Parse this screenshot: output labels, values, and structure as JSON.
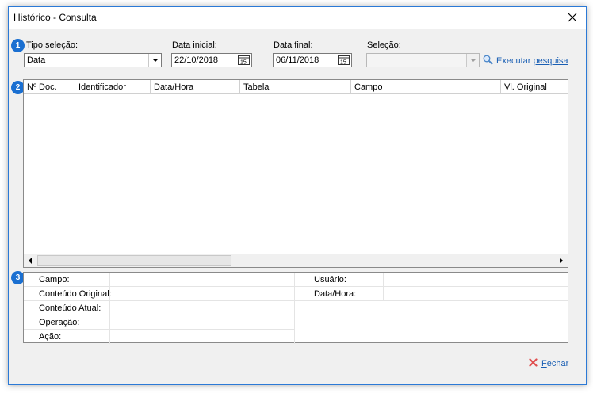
{
  "window": {
    "title": "Histórico - Consulta"
  },
  "badges": [
    "1",
    "2",
    "3"
  ],
  "filters": {
    "tipo_selecao": {
      "label": "Tipo seleção:",
      "value": "Data"
    },
    "data_inicial": {
      "label": "Data inicial:",
      "value": "22/10/2018"
    },
    "data_final": {
      "label": "Data final:",
      "value": "06/11/2018"
    },
    "selecao": {
      "label": "Seleção:",
      "value": ""
    },
    "execute": {
      "prefix": "Executar ",
      "underlined": "pesquisa"
    }
  },
  "grid": {
    "columns": [
      "Nº Doc.",
      "Identificador",
      "Data/Hora",
      "Tabela",
      "Campo",
      "Vl. Original"
    ],
    "rows": []
  },
  "details": {
    "left": [
      "Campo:",
      "Conteúdo Original:",
      "Conteúdo Atual:",
      "Operação:",
      "Ação:"
    ],
    "right": [
      "Usuário:",
      "Data/Hora:"
    ]
  },
  "footer": {
    "close_underlined": "F",
    "close_rest": "echar"
  },
  "colors": {
    "accent": "#1a6fd1",
    "link": "#1a5fb4",
    "window_border": "#2b79d6",
    "close_x": "#e05050"
  },
  "icons": {
    "close": "close-icon",
    "dropdown": "chevron-down-icon",
    "calendar": "calendar-icon",
    "search": "magnifier-icon",
    "fechar": "red-x-icon",
    "scroll_left": "arrow-left-icon",
    "scroll_right": "arrow-right-icon"
  }
}
